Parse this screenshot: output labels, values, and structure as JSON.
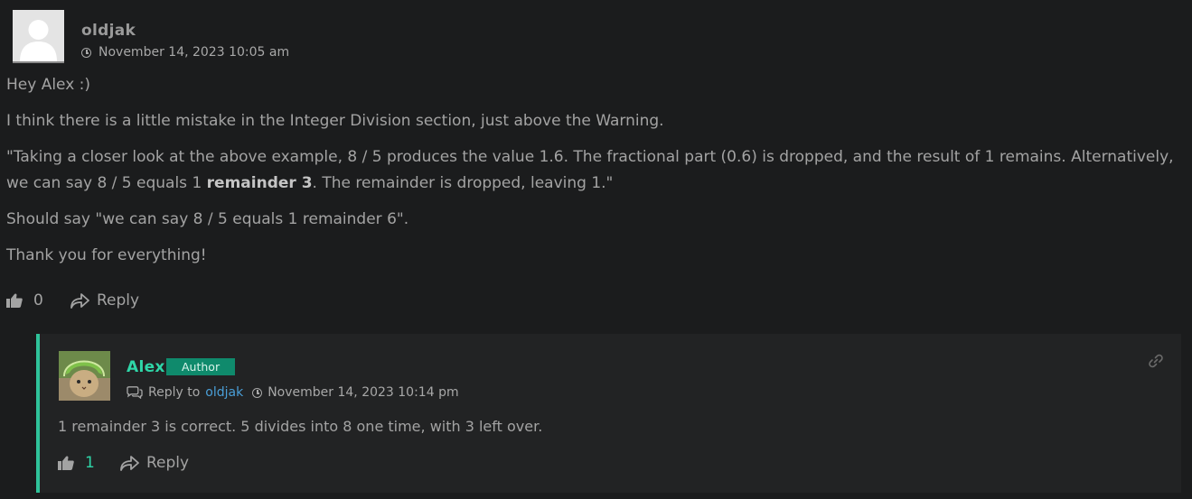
{
  "comment": {
    "author": "oldjak",
    "date": "November 14, 2023 10:05 am",
    "paragraphs": {
      "p1": "Hey Alex :)",
      "p2": "I think there is a little mistake in the Integer Division section, just above the Warning.",
      "p3_a": "\"Taking a closer look at the above example, 8 / 5 produces the value 1.6. The fractional part (0.6) is dropped, and the result of 1 remains. Alternatively, we can say 8 / 5 equals 1 ",
      "p3_bold": "remainder 3",
      "p3_b": ". The remainder is dropped, leaving 1.\"",
      "p4": "Should say \"we can say 8 / 5 equals 1 remainder 6\".",
      "p5": "Thank you for everything!"
    },
    "likes": "0",
    "reply_label": "Reply"
  },
  "reply": {
    "author": "Alex",
    "badge": "Author",
    "reply_to_label": "Reply to",
    "reply_to_user": "oldjak",
    "date": "November 14, 2023 10:14 pm",
    "text": "1 remainder 3 is correct. 5 divides into 8 one time, with 3 left over.",
    "likes": "1",
    "reply_label": "Reply"
  },
  "colors": {
    "background": "#1b1c1d",
    "reply_background": "#222324",
    "accent": "#2fd6a8",
    "badge": "#0f8a6c",
    "link": "#4a9fd8"
  },
  "icons": {
    "clock": "clock-icon",
    "thumbs_up": "thumbs-up-icon",
    "reply": "reply-arrow-icon",
    "replies": "comments-icon",
    "permalink": "link-icon"
  }
}
